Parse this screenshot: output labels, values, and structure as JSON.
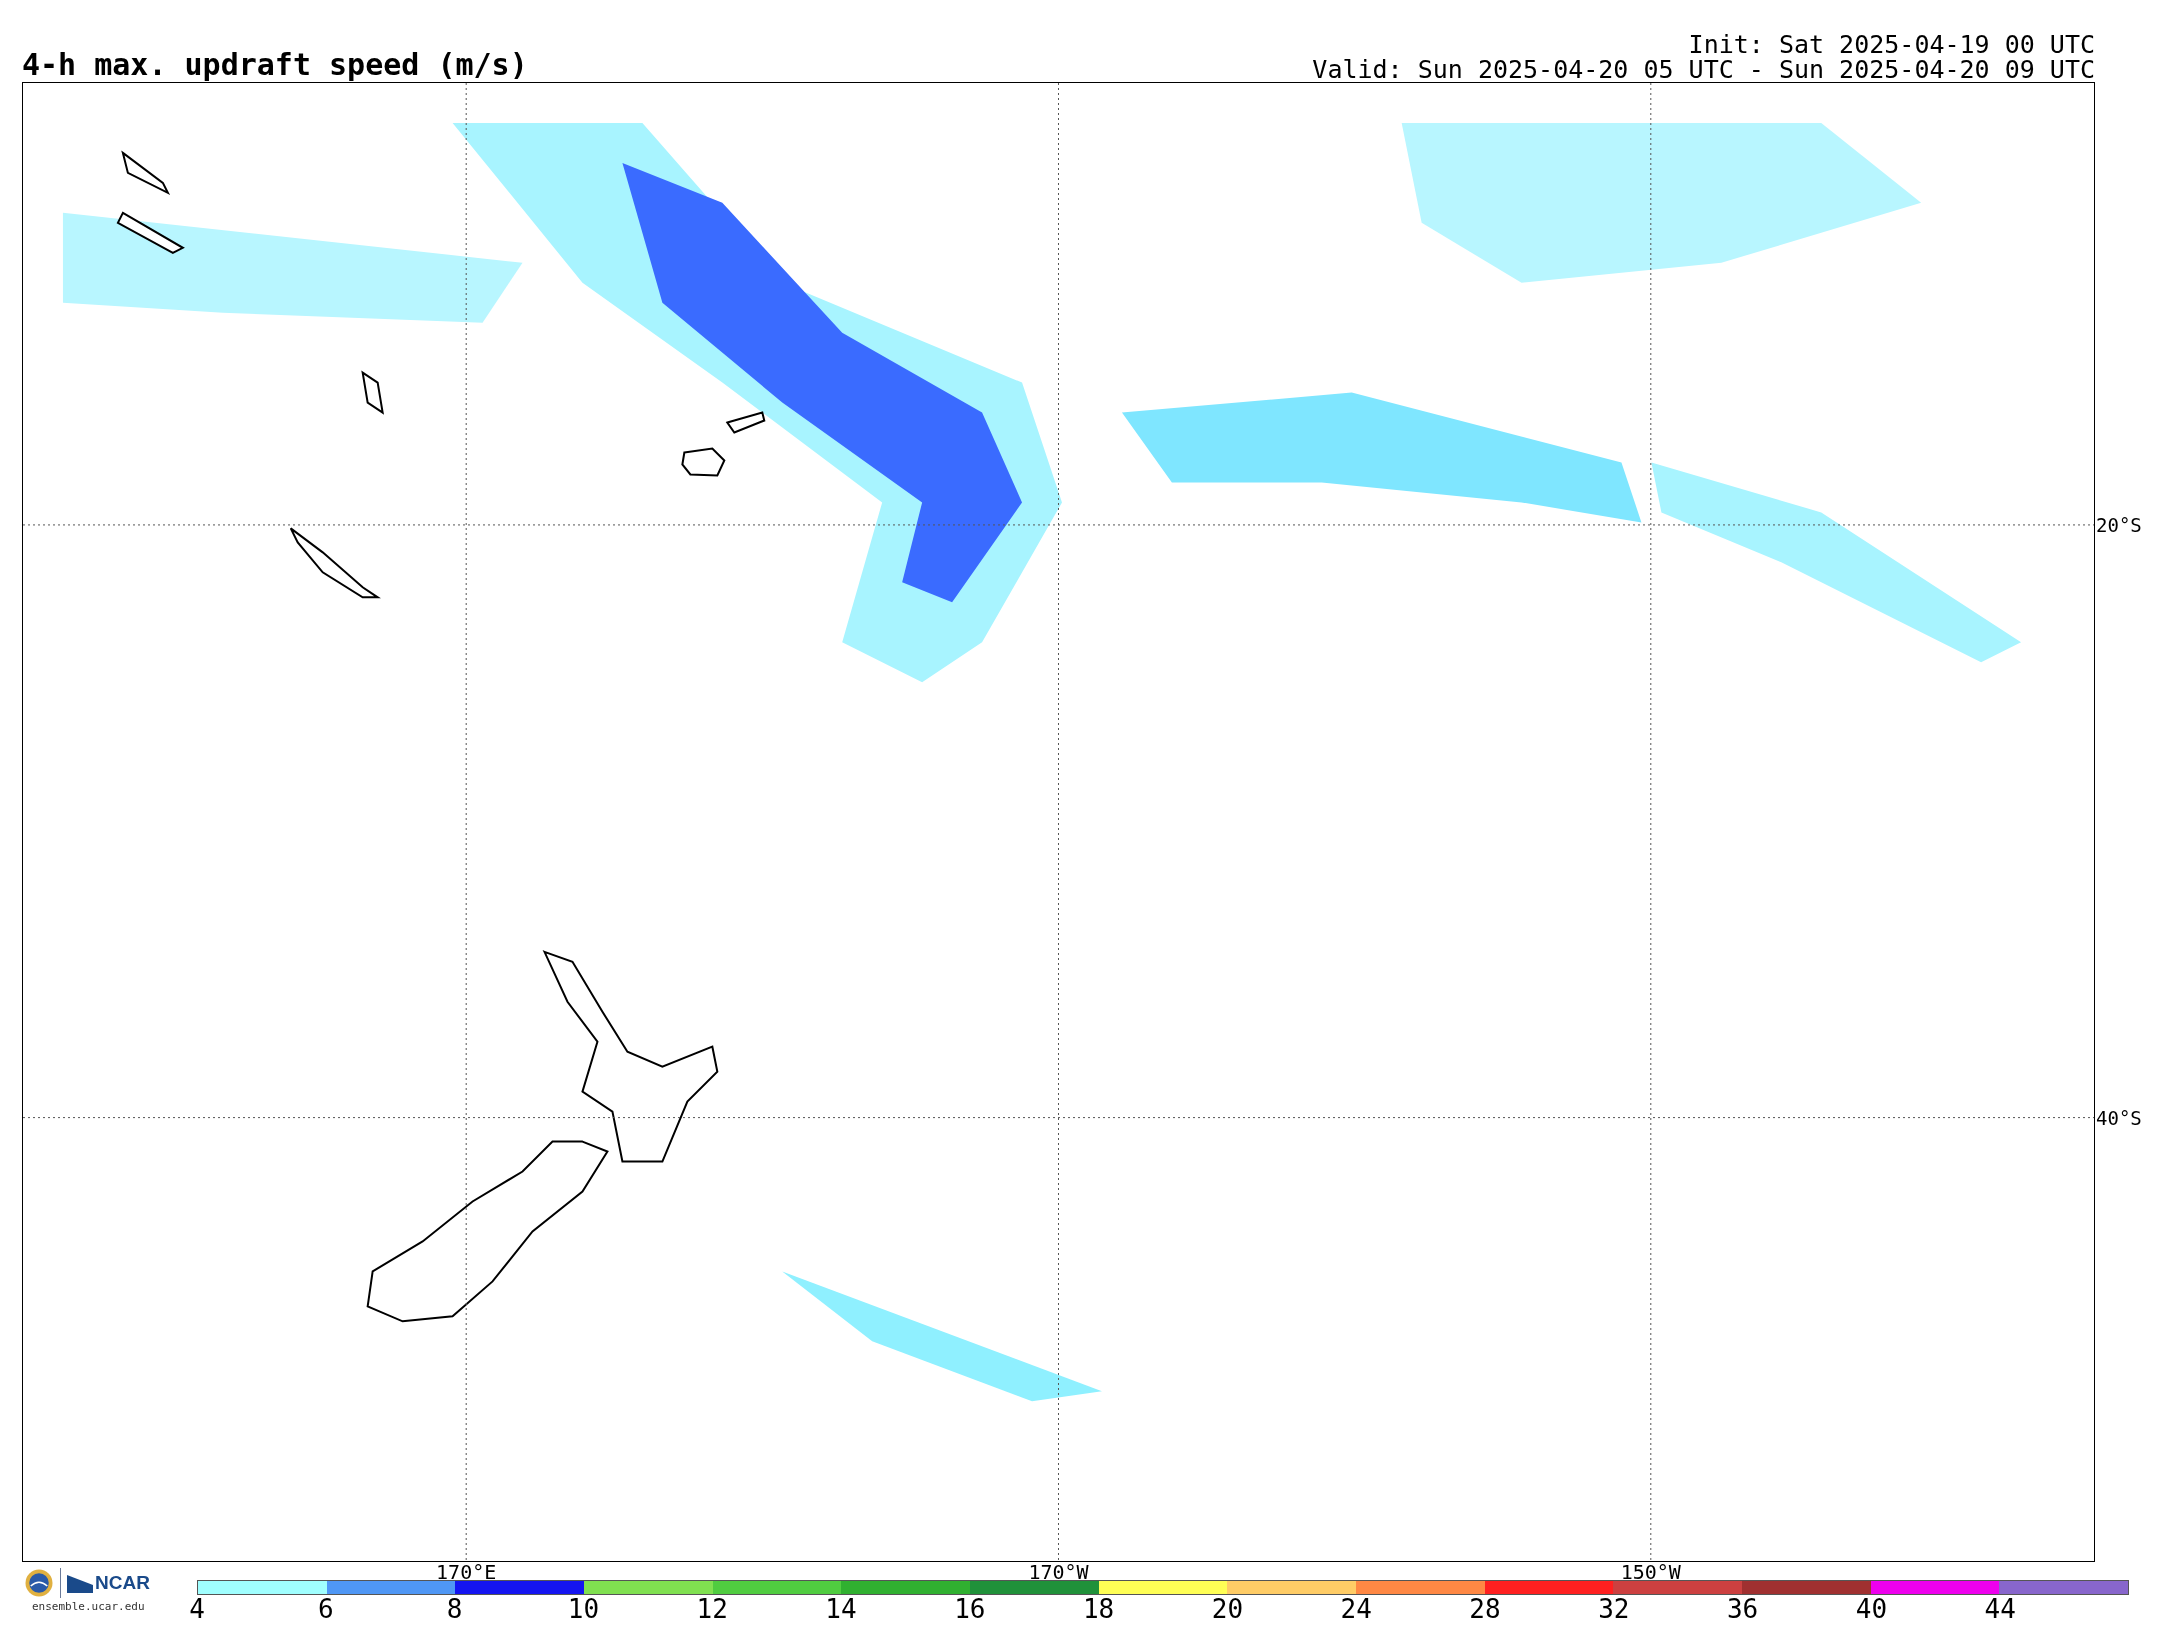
{
  "title": "4-h max. updraft speed (m/s)",
  "init": "Init: Sat 2025-04-19 00 UTC",
  "valid": "Valid: Sun 2025-04-20 05 UTC - Sun 2025-04-20 09 UTC",
  "map": {
    "longitude_labels": [
      "170°E",
      "170°W",
      "150°W"
    ],
    "latitude_labels": [
      "20°S",
      "40°S"
    ]
  },
  "logo": {
    "org": "NCAR",
    "url": "ensemble.ucar.edu"
  },
  "colorbar": [
    {
      "label": "4",
      "color": "#a0ffff"
    },
    {
      "label": "6",
      "color": "#4f97f5"
    },
    {
      "label": "8",
      "color": "#1414f0"
    },
    {
      "label": "10",
      "color": "#80e050"
    },
    {
      "label": "12",
      "color": "#50cc40"
    },
    {
      "label": "14",
      "color": "#30b030"
    },
    {
      "label": "16",
      "color": "#20913a"
    },
    {
      "label": "18",
      "color": "#ffff55"
    },
    {
      "label": "20",
      "color": "#ffcc66"
    },
    {
      "label": "24",
      "color": "#ff8844"
    },
    {
      "label": "28",
      "color": "#ff2020"
    },
    {
      "label": "32",
      "color": "#cc4040"
    },
    {
      "label": "36",
      "color": "#a03030"
    },
    {
      "label": "40",
      "color": "#ee00ee"
    },
    {
      "label": "44",
      "color": "#8866cc"
    }
  ]
}
